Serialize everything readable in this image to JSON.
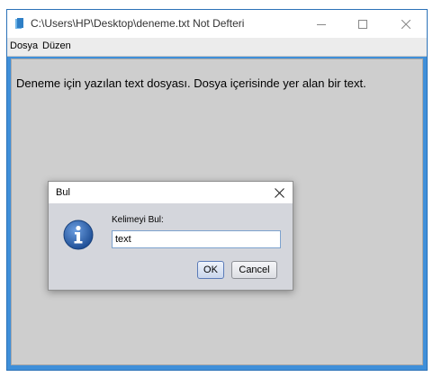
{
  "window": {
    "title": "C:\\Users\\HP\\Desktop\\deneme.txt Not Defteri",
    "controls": {
      "minimize": "minimize-icon",
      "maximize": "maximize-icon",
      "close": "close-icon"
    }
  },
  "menubar": {
    "items": [
      {
        "label": "Dosya"
      },
      {
        "label": "Düzen"
      }
    ]
  },
  "editor": {
    "content": "Deneme için yazılan text dosyası. Dosya içerisinde yer alan bir text."
  },
  "dialog": {
    "title": "Bul",
    "label": "Kelimeyi Bul:",
    "input_value": "text",
    "ok_label": "OK",
    "cancel_label": "Cancel",
    "icon": "info-icon"
  },
  "colors": {
    "window_border": "#3f8fd9",
    "text_area": "#cecece",
    "dialog_bg": "#d4d6dc",
    "info_icon": "#2c5aa0"
  }
}
